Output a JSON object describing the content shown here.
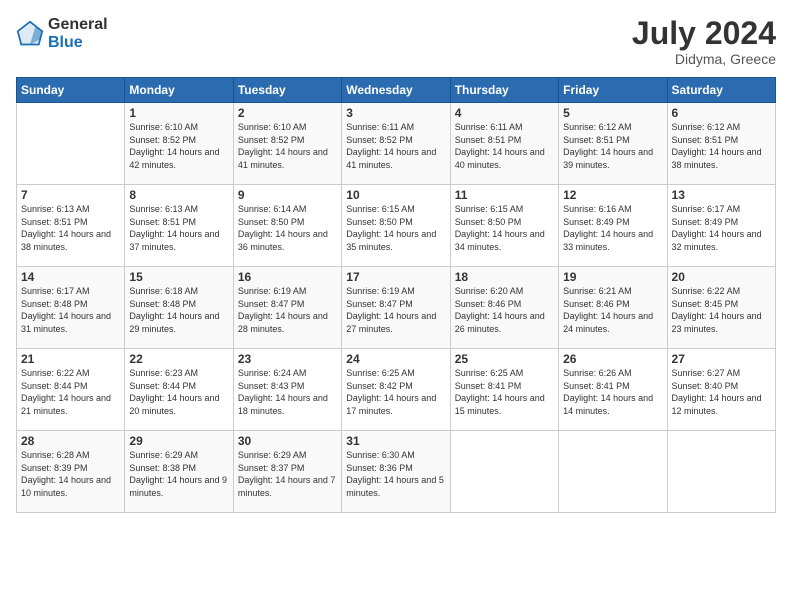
{
  "logo": {
    "general": "General",
    "blue": "Blue"
  },
  "title": {
    "month_year": "July 2024",
    "location": "Didyma, Greece"
  },
  "days_of_week": [
    "Sunday",
    "Monday",
    "Tuesday",
    "Wednesday",
    "Thursday",
    "Friday",
    "Saturday"
  ],
  "weeks": [
    [
      {
        "day": "",
        "sunrise": "",
        "sunset": "",
        "daylight": ""
      },
      {
        "day": "1",
        "sunrise": "Sunrise: 6:10 AM",
        "sunset": "Sunset: 8:52 PM",
        "daylight": "Daylight: 14 hours and 42 minutes."
      },
      {
        "day": "2",
        "sunrise": "Sunrise: 6:10 AM",
        "sunset": "Sunset: 8:52 PM",
        "daylight": "Daylight: 14 hours and 41 minutes."
      },
      {
        "day": "3",
        "sunrise": "Sunrise: 6:11 AM",
        "sunset": "Sunset: 8:52 PM",
        "daylight": "Daylight: 14 hours and 41 minutes."
      },
      {
        "day": "4",
        "sunrise": "Sunrise: 6:11 AM",
        "sunset": "Sunset: 8:51 PM",
        "daylight": "Daylight: 14 hours and 40 minutes."
      },
      {
        "day": "5",
        "sunrise": "Sunrise: 6:12 AM",
        "sunset": "Sunset: 8:51 PM",
        "daylight": "Daylight: 14 hours and 39 minutes."
      },
      {
        "day": "6",
        "sunrise": "Sunrise: 6:12 AM",
        "sunset": "Sunset: 8:51 PM",
        "daylight": "Daylight: 14 hours and 38 minutes."
      }
    ],
    [
      {
        "day": "7",
        "sunrise": "Sunrise: 6:13 AM",
        "sunset": "Sunset: 8:51 PM",
        "daylight": "Daylight: 14 hours and 38 minutes."
      },
      {
        "day": "8",
        "sunrise": "Sunrise: 6:13 AM",
        "sunset": "Sunset: 8:51 PM",
        "daylight": "Daylight: 14 hours and 37 minutes."
      },
      {
        "day": "9",
        "sunrise": "Sunrise: 6:14 AM",
        "sunset": "Sunset: 8:50 PM",
        "daylight": "Daylight: 14 hours and 36 minutes."
      },
      {
        "day": "10",
        "sunrise": "Sunrise: 6:15 AM",
        "sunset": "Sunset: 8:50 PM",
        "daylight": "Daylight: 14 hours and 35 minutes."
      },
      {
        "day": "11",
        "sunrise": "Sunrise: 6:15 AM",
        "sunset": "Sunset: 8:50 PM",
        "daylight": "Daylight: 14 hours and 34 minutes."
      },
      {
        "day": "12",
        "sunrise": "Sunrise: 6:16 AM",
        "sunset": "Sunset: 8:49 PM",
        "daylight": "Daylight: 14 hours and 33 minutes."
      },
      {
        "day": "13",
        "sunrise": "Sunrise: 6:17 AM",
        "sunset": "Sunset: 8:49 PM",
        "daylight": "Daylight: 14 hours and 32 minutes."
      }
    ],
    [
      {
        "day": "14",
        "sunrise": "Sunrise: 6:17 AM",
        "sunset": "Sunset: 8:48 PM",
        "daylight": "Daylight: 14 hours and 31 minutes."
      },
      {
        "day": "15",
        "sunrise": "Sunrise: 6:18 AM",
        "sunset": "Sunset: 8:48 PM",
        "daylight": "Daylight: 14 hours and 29 minutes."
      },
      {
        "day": "16",
        "sunrise": "Sunrise: 6:19 AM",
        "sunset": "Sunset: 8:47 PM",
        "daylight": "Daylight: 14 hours and 28 minutes."
      },
      {
        "day": "17",
        "sunrise": "Sunrise: 6:19 AM",
        "sunset": "Sunset: 8:47 PM",
        "daylight": "Daylight: 14 hours and 27 minutes."
      },
      {
        "day": "18",
        "sunrise": "Sunrise: 6:20 AM",
        "sunset": "Sunset: 8:46 PM",
        "daylight": "Daylight: 14 hours and 26 minutes."
      },
      {
        "day": "19",
        "sunrise": "Sunrise: 6:21 AM",
        "sunset": "Sunset: 8:46 PM",
        "daylight": "Daylight: 14 hours and 24 minutes."
      },
      {
        "day": "20",
        "sunrise": "Sunrise: 6:22 AM",
        "sunset": "Sunset: 8:45 PM",
        "daylight": "Daylight: 14 hours and 23 minutes."
      }
    ],
    [
      {
        "day": "21",
        "sunrise": "Sunrise: 6:22 AM",
        "sunset": "Sunset: 8:44 PM",
        "daylight": "Daylight: 14 hours and 21 minutes."
      },
      {
        "day": "22",
        "sunrise": "Sunrise: 6:23 AM",
        "sunset": "Sunset: 8:44 PM",
        "daylight": "Daylight: 14 hours and 20 minutes."
      },
      {
        "day": "23",
        "sunrise": "Sunrise: 6:24 AM",
        "sunset": "Sunset: 8:43 PM",
        "daylight": "Daylight: 14 hours and 18 minutes."
      },
      {
        "day": "24",
        "sunrise": "Sunrise: 6:25 AM",
        "sunset": "Sunset: 8:42 PM",
        "daylight": "Daylight: 14 hours and 17 minutes."
      },
      {
        "day": "25",
        "sunrise": "Sunrise: 6:25 AM",
        "sunset": "Sunset: 8:41 PM",
        "daylight": "Daylight: 14 hours and 15 minutes."
      },
      {
        "day": "26",
        "sunrise": "Sunrise: 6:26 AM",
        "sunset": "Sunset: 8:41 PM",
        "daylight": "Daylight: 14 hours and 14 minutes."
      },
      {
        "day": "27",
        "sunrise": "Sunrise: 6:27 AM",
        "sunset": "Sunset: 8:40 PM",
        "daylight": "Daylight: 14 hours and 12 minutes."
      }
    ],
    [
      {
        "day": "28",
        "sunrise": "Sunrise: 6:28 AM",
        "sunset": "Sunset: 8:39 PM",
        "daylight": "Daylight: 14 hours and 10 minutes."
      },
      {
        "day": "29",
        "sunrise": "Sunrise: 6:29 AM",
        "sunset": "Sunset: 8:38 PM",
        "daylight": "Daylight: 14 hours and 9 minutes."
      },
      {
        "day": "30",
        "sunrise": "Sunrise: 6:29 AM",
        "sunset": "Sunset: 8:37 PM",
        "daylight": "Daylight: 14 hours and 7 minutes."
      },
      {
        "day": "31",
        "sunrise": "Sunrise: 6:30 AM",
        "sunset": "Sunset: 8:36 PM",
        "daylight": "Daylight: 14 hours and 5 minutes."
      },
      {
        "day": "",
        "sunrise": "",
        "sunset": "",
        "daylight": ""
      },
      {
        "day": "",
        "sunrise": "",
        "sunset": "",
        "daylight": ""
      },
      {
        "day": "",
        "sunrise": "",
        "sunset": "",
        "daylight": ""
      }
    ]
  ]
}
